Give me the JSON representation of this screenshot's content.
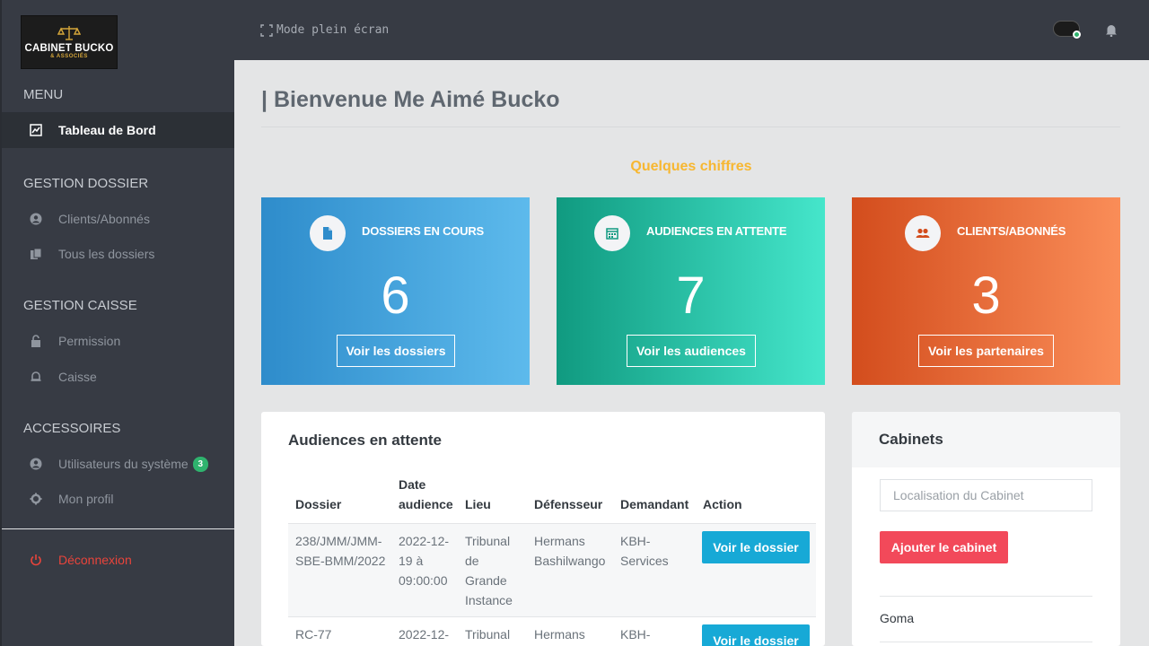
{
  "logo": {
    "brand": "CABINET BUCKO",
    "sub": "& ASSOCIÉS"
  },
  "topbar": {
    "fullscreen_label": "Mode plein écran",
    "status_color": "#2fb36e"
  },
  "sidebar": {
    "menu_title": "MENU",
    "dashboard": "Tableau de Bord",
    "gestion_dossier_title": "GESTION DOSSIER",
    "clients": "Clients/Abonnés",
    "dossiers": "Tous les dossiers",
    "gestion_caisse_title": "GESTION CAISSE",
    "permission": "Permission",
    "caisse": "Caisse",
    "accessoires_title": "ACCESSOIRES",
    "utilisateurs": "Utilisateurs du système",
    "utilisateurs_badge": "3",
    "profil": "Mon profil",
    "logout": "Déconnexion"
  },
  "main": {
    "title": "| Bienvenue Me Aimé Bucko",
    "section_heading": "Quelques chiffres",
    "cards": [
      {
        "label": "DOSSIERS EN COURS",
        "value": "6",
        "button": "Voir les dossiers",
        "icon": "file-icon"
      },
      {
        "label": "AUDIENCES EN ATTENTE",
        "value": "7",
        "button": "Voir les audiences",
        "icon": "calendar-icon"
      },
      {
        "label": "CLIENTS/ABONNÉS",
        "value": "3",
        "button": "Voir les partenaires",
        "icon": "users-icon"
      }
    ]
  },
  "audiences": {
    "title": "Audiences en attente",
    "columns": [
      "Dossier",
      "Date audience",
      "Lieu",
      "Défensseur",
      "Demandant",
      "Action"
    ],
    "rows": [
      {
        "dossier": "238/JMM/JMM-SBE-BMM/2022",
        "date": "2022-12-19 à 09:00:00",
        "lieu": "Tribunal de Grande Instance",
        "defenseur": "Hermans Bashilwango",
        "demandant": "KBH-Services",
        "action": "Voir le dossier"
      },
      {
        "dossier": "RC-77",
        "date": "2022-12-",
        "lieu": "Tribunal",
        "defenseur": "Hermans",
        "demandant": "KBH-",
        "action": "Voir le dossier"
      }
    ]
  },
  "cabinets": {
    "title": "Cabinets",
    "input_placeholder": "Localisation du Cabinet",
    "add_button": "Ajouter le cabinet",
    "items": [
      "Goma"
    ]
  }
}
